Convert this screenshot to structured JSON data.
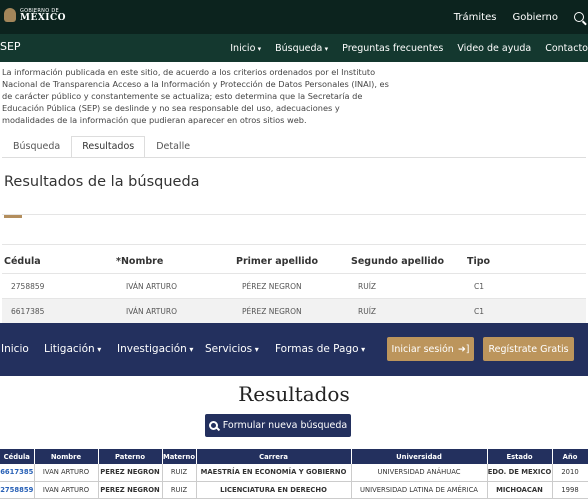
{
  "gov_header": {
    "logo_small": "GOBIERNO DE",
    "logo_big": "MÉXICO",
    "links": [
      "Trámites",
      "Gobierno"
    ]
  },
  "sep_header": {
    "title": "SEP",
    "nav": [
      "Inicio",
      "Búsqueda",
      "Preguntas frecuentes",
      "Video de ayuda",
      "Contacto"
    ]
  },
  "disclaimer": "La información publicada en este sitio, de acuerdo a los criterios ordenados por el Instituto Nacional de Transparencia  Acceso a la Información y Protección de Datos Personales (INAI), es de carácter público y constantemente se actualiza; esto determina que la Secretaría de Educación Pública (SEP) se deslinde y no sea responsable del uso, adecuaciones y modalidades de la información que pudieran aparecer en otros sitios web.",
  "tabs": [
    "Búsqueda",
    "Resultados",
    "Detalle"
  ],
  "results_section": {
    "title": "Resultados de la búsqueda",
    "columns": [
      "Cédula",
      "*Nombre",
      "Primer apellido",
      "Segundo apellido",
      "Tipo"
    ],
    "rows": [
      [
        "2758859",
        "IVÁN ARTURO",
        "PÉREZ NEGRON",
        "RUÍZ",
        "C1"
      ],
      [
        "6617385",
        "IVÁN ARTURO",
        "PÉREZ NEGRON",
        "RUÍZ",
        "C1"
      ]
    ]
  },
  "portal_nav": {
    "items": [
      "Inicio",
      "Litigación",
      "Investigación",
      "Servicios",
      "Formas de Pago"
    ],
    "login": "Iniciar sesión",
    "register": "Regístrate Gratis"
  },
  "portal_results": {
    "title": "Resultados",
    "new_search": "Formular nueva búsqueda",
    "columns": [
      "Cédula",
      "Nombre",
      "Paterno",
      "Materno",
      "Carrera",
      "Universidad",
      "Estado",
      "Año"
    ],
    "rows": [
      [
        "6617385",
        "IVAN ARTURO",
        "PEREZ NEGRON",
        "RUIZ",
        "MAESTRÍA EN ECONOMÍA Y GOBIERNO",
        "UNIVERSIDAD ANÁHUAC",
        "EDO. DE MEXICO",
        "2010"
      ],
      [
        "2758859",
        "IVAN ARTURO",
        "PEREZ NEGRON",
        "RUIZ",
        "LICENCIATURA EN DERECHO",
        "UNIVERSIDAD LATINA DE AMÉRICA",
        "MICHOACAN",
        "1998"
      ]
    ]
  },
  "colors": {
    "gov_bar": "#0c231e",
    "sep_bar": "#14382f",
    "accent_gold": "#b38e5d",
    "portal_navy": "#23305e",
    "link_blue": "#2a62b7"
  }
}
